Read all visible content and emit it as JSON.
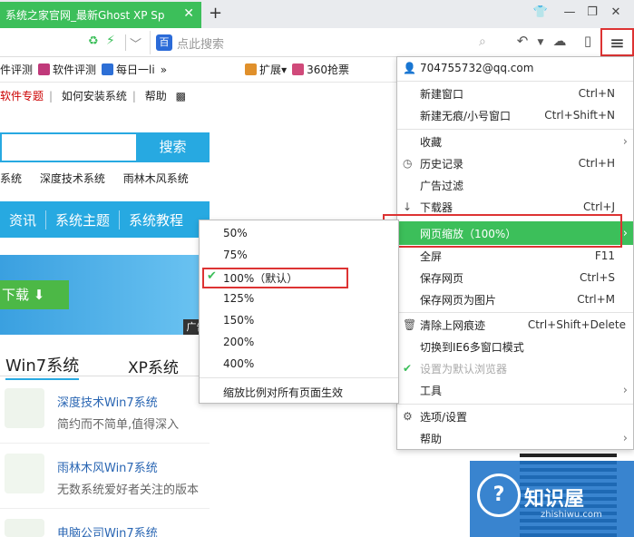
{
  "tab": {
    "title": "系统之家官网_最新Ghost XP Sp",
    "close": "✕"
  },
  "titlebar": {
    "new_tab": "+"
  },
  "address": {
    "search_placeholder": "点此搜索",
    "baidu_logo": "百"
  },
  "bookmarks": {
    "items": [
      {
        "label": "件评测"
      },
      {
        "label": "软件评测"
      },
      {
        "label": "每日一li"
      },
      {
        "label": "»"
      },
      {
        "label": "扩展"
      },
      {
        "label": "360抢票"
      }
    ]
  },
  "page": {
    "top_links": [
      "软件专题",
      "如何安装系统",
      "帮助"
    ],
    "search_button": "搜索",
    "sys_links": [
      "系统",
      "深度技术系统",
      "雨林木风系统"
    ],
    "nav": [
      "资讯",
      "系统主题",
      "系统教程"
    ],
    "banner_button": "下载",
    "banner_ad": "广告",
    "os_tabs": [
      "Win7系统",
      "XP系统"
    ],
    "list": [
      {
        "title": "深度技术Win7系统",
        "desc": "简约而不简单,值得深入"
      },
      {
        "title": "雨林木风Win7系统",
        "desc": "无数系统爱好者关注的版本"
      },
      {
        "title": "电脑公司Win7系统",
        "desc": ""
      }
    ],
    "watermark": {
      "cn": "知识屋",
      "en": "zhishiwu.com",
      "logo": "?"
    }
  },
  "menu": {
    "account": "704755732@qq.com",
    "items": [
      {
        "label": "新建窗口",
        "shortcut": "Ctrl+N"
      },
      {
        "label": "新建无痕/小号窗口",
        "shortcut": "Ctrl+Shift+N"
      },
      {
        "label": "收藏",
        "shortcut": ""
      },
      {
        "label": "历史记录",
        "shortcut": "Ctrl+H"
      },
      {
        "label": "广告过滤",
        "shortcut": ""
      },
      {
        "label": "下载器",
        "shortcut": "Ctrl+J"
      },
      {
        "label": "网页缩放（100%）",
        "shortcut": ""
      },
      {
        "label": "全屏",
        "shortcut": "F11"
      },
      {
        "label": "保存网页",
        "shortcut": "Ctrl+S"
      },
      {
        "label": "保存网页为图片",
        "shortcut": "Ctrl+M"
      },
      {
        "label": "清除上网痕迹",
        "shortcut": "Ctrl+Shift+Delete"
      },
      {
        "label": "切换到IE6多窗口模式",
        "shortcut": ""
      },
      {
        "label": "设置为默认浏览器",
        "shortcut": ""
      },
      {
        "label": "工具",
        "shortcut": ""
      },
      {
        "label": "选项/设置",
        "shortcut": ""
      },
      {
        "label": "帮助",
        "shortcut": ""
      }
    ]
  },
  "zoom_menu": {
    "levels": [
      "50%",
      "75%",
      "100%（默认）",
      "125%",
      "150%",
      "200%",
      "400%"
    ],
    "apply_all": "缩放比例对所有页面生效",
    "selected_index": 2
  },
  "colors": {
    "accent_green": "#3cbf5a",
    "site_blue": "#27a9e1",
    "highlight_red": "#dd3333"
  }
}
